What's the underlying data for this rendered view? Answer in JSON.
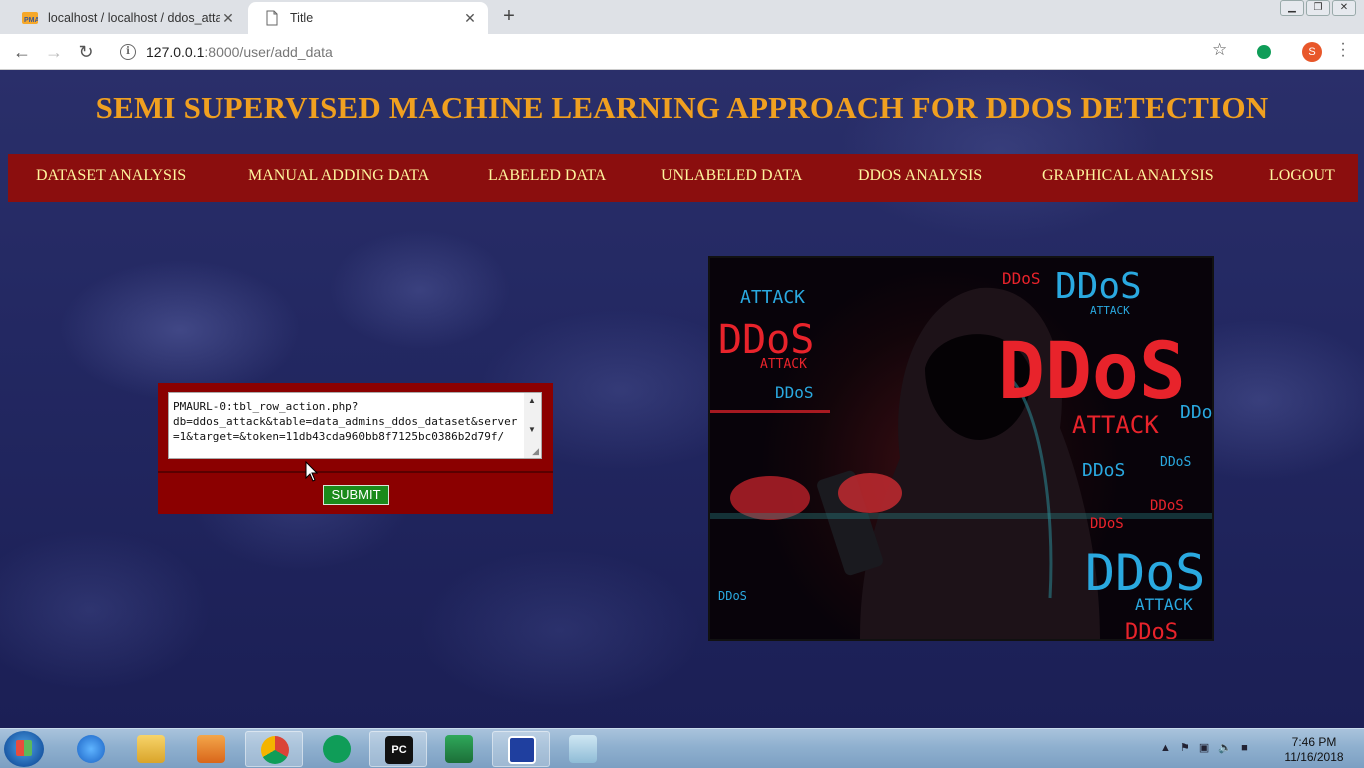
{
  "browser": {
    "tabs": [
      {
        "title": "localhost / localhost / ddos_attac",
        "active": false
      },
      {
        "title": "Title",
        "active": true
      }
    ],
    "url_host": "127.0.0.1",
    "url_rest": ":8000/user/add_data",
    "profile_initial": "S"
  },
  "site": {
    "title": "SEMI SUPERVISED MACHINE LEARNING APPROACH FOR DDOS DETECTION",
    "nav": [
      "DATASET ANALYSIS",
      "MANUAL ADDING DATA",
      "LABELED DATA",
      "UNLABELED DATA",
      "DDOS ANALYSIS",
      "GRAPHICAL ANALYSIS",
      "LOGOUT"
    ]
  },
  "form": {
    "textarea_value": "PMAURL-0:tbl_row_action.php?\ndb=ddos_attack&table=data_admins_ddos_dataset&server=1&target=&token=11db43cda960bb8f7125bc0386b2d79f/",
    "submit_label": "SUBMIT"
  },
  "hero_image": {
    "text_big": "DDoS",
    "text_attack": "ATTACK",
    "colors": {
      "red": "#e8232b",
      "blue": "#2aa9e0"
    }
  },
  "taskbar": {
    "time": "7:46 PM",
    "date": "11/16/2018"
  }
}
